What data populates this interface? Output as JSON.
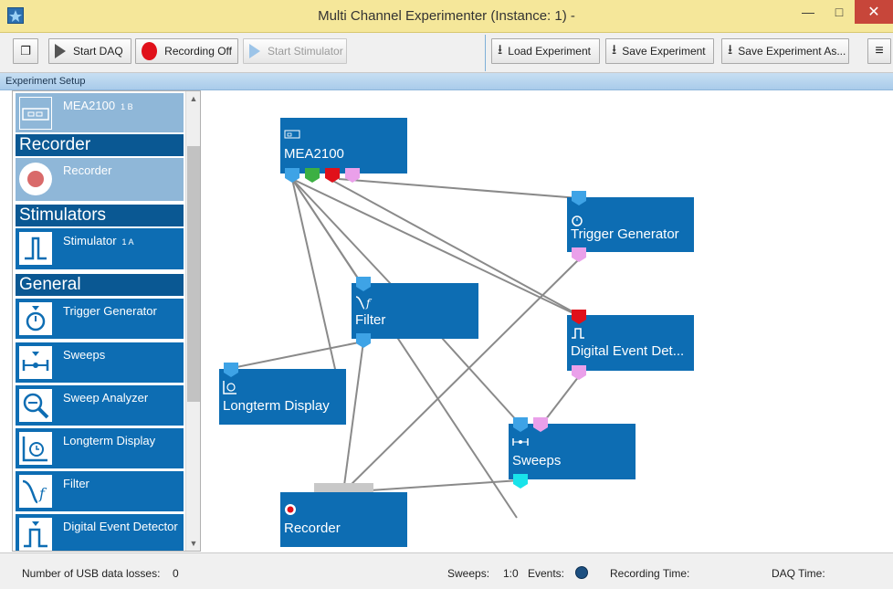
{
  "window": {
    "title": "Multi Channel Experimenter (Instance: 1) -"
  },
  "toolbar": {
    "start_daq": "Start DAQ",
    "recording": "Recording Off",
    "start_stimulator": "Start Stimulator",
    "load_experiment": "Load Experiment",
    "save_experiment": "Save Experiment",
    "save_experiment_as": "Save Experiment As..."
  },
  "section": {
    "title": "Experiment Setup"
  },
  "sidebar": {
    "device": {
      "label": "MEA2100",
      "sup": "1 B"
    },
    "categories": [
      "Recorder",
      "Stimulators",
      "General"
    ],
    "recorder": {
      "label": "Recorder"
    },
    "stimulator": {
      "label": "Stimulator",
      "sup": "1 A"
    },
    "general_items": [
      {
        "label": "Trigger Generator",
        "icon": "stopwatch-icon"
      },
      {
        "label": "Sweeps",
        "icon": "sweep-icon"
      },
      {
        "label": "Sweep Analyzer",
        "icon": "magnifier-icon"
      },
      {
        "label": "Longterm Display",
        "icon": "clock-chart-icon"
      },
      {
        "label": "Filter",
        "icon": "filter-icon"
      },
      {
        "label": "Digital Event Detector",
        "icon": "pulse-icon"
      }
    ]
  },
  "canvas": {
    "nodes": {
      "mea": "MEA2100",
      "trigger": "Trigger Generator",
      "filter": "Filter",
      "digital": "Digital Event Det...",
      "longterm": "Longterm Display",
      "sweeps": "Sweeps",
      "recorder": "Recorder"
    }
  },
  "status": {
    "usb_losses_label": "Number of USB data losses:",
    "usb_losses_value": "0",
    "sweeps_label": "Sweeps:",
    "sweeps_value": "1:0",
    "events_label": "Events:",
    "recording_time_label": "Recording Time:",
    "daq_time_label": "DAQ Time:"
  },
  "colors": {
    "node_blue": "#0d6db3",
    "port_blue": "#3ea3e6",
    "port_green": "#3cb043",
    "port_red": "#e0101a",
    "port_pink": "#eaa0ea",
    "port_cyan": "#19e3ea"
  }
}
